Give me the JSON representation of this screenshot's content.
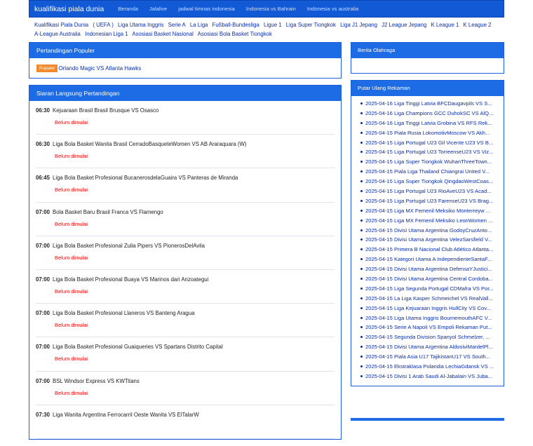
{
  "header": {
    "brand": "kualifikasi piala dunia",
    "nav": [
      "Beranda",
      "Jalalive",
      "jadwal timnas indonesia",
      "Indonesia vs Bahrain",
      "Indonesia vs australia"
    ]
  },
  "categories": [
    "Kualifikasi Piala Dunia",
    "( UEFA )",
    "Liga Utama Inggris",
    "Serie A",
    "La Liga",
    "Fußball-Bundesliga",
    "Ligue 1",
    "Liga Super Tiongkok",
    "Liga J1 Jepang",
    "J2 League Jepang",
    "K League 1",
    "K League 2",
    "A-League Australia",
    "Indonesian Liga 1",
    "Asosiasi Basket Nasional",
    "Asosiasi Bola Basket Tiongkok"
  ],
  "popular": {
    "title": "Pertandingan Populer",
    "badge": "Populer",
    "match": "Orlando Magic VS Atlanta Hawks"
  },
  "live": {
    "title": "Siaran Langsung Pertandingan",
    "matches": [
      {
        "time": "06:30",
        "name": "Kejuaraan Brasil Brasil Brusque VS Osasco",
        "status": "Belum dimulai"
      },
      {
        "time": "06:30",
        "name": "Liga Bola Basket Wanita Brasil CerradoBasqueteWomen VS AB Araraquara (W)",
        "status": "Belum dimulai"
      },
      {
        "time": "06:45",
        "name": "Liga Bola Basket Profesional BucanerosdelaGuaira VS Panteras de Miranda",
        "status": "Belum dimulai"
      },
      {
        "time": "07:00",
        "name": "Bola Basket Baru Brasil Franca VS Flamengo",
        "status": "Belum dimulai"
      },
      {
        "time": "07:00",
        "name": "Liga Bola Basket Profesional Zulia Pipers VS PionerosDelAvila",
        "status": "Belum dimulai"
      },
      {
        "time": "07:00",
        "name": "Liga Bola Basket Profesional Buaya VS Marinos dari Anzoategui",
        "status": "Belum dimulai"
      },
      {
        "time": "07:00",
        "name": "Liga Bola Basket Profesional Llaneros VS Banteng Aragua",
        "status": "Belum dimulai"
      },
      {
        "time": "07:00",
        "name": "Liga Bola Basket Profesional Guaiqueries VS Spartans Distrito Capital",
        "status": "Belum dimulai"
      },
      {
        "time": "07:00",
        "name": "BSL Windsor Express VS KWTitans",
        "status": "Belum dimulai"
      },
      {
        "time": "07:30",
        "name": "Liga Wanita Argentina Ferrocarril Oeste Wanita VS ElTalarW",
        "status": ""
      }
    ]
  },
  "news": {
    "title": "Berita Olahraga"
  },
  "replays": {
    "title": "Putar Ulang Rekaman",
    "items": [
      "2025-04-16 Liga Tinggi Latvia BFCDaugavpils VS S...",
      "2025-04-16 Liga Champions GCC DuhokSC VS AlQ...",
      "2025-04-16 Liga Tinggi Latvia Grobina VS RFS Rek...",
      "2025-04-15 Piala Rusia LokomotivMoscow VS Akh...",
      "2025-04-15 Liga Portugal U23 Gil Vicente U23 VS B...",
      "2025-04-15 Liga Portugal U23 TorreenseU23 VS Viz...",
      "2025-04-15 Liga Super Tiongkok WuhanThreeTown...",
      "2025-04-15 Piala Liga Thailand Chiangrai United V...",
      "2025-04-15 Liga Super Tiongkok QingdaoWestCoas...",
      "2025-04-15 Liga Portugal U23 RioAveU23 VS Acad...",
      "2025-04-15 Liga Portugal U23 FarenseU23 VS Brag...",
      "2025-04-15 Liga MX Femenil Meksiko Monterreyw ...",
      "2025-04-15 Liga MX Femenil Meksiko LeonWomen ...",
      "2025-04-15 Divisi Utama Argentina GodoyCruzAnto...",
      "2025-04-15 Divisi Utama Argentina VelezSarsfield V...",
      "2025-04-15 Primera B Nacional Club Atlético Atlanta...",
      "2025-04-15 Kategori Utama A IndependienteSantaF...",
      "2025-04-15 Divisi Utama Argentina DefensaYJustici...",
      "2025-04-15 Divisi Utama Argentina Central Cordoba...",
      "2025-04-15 Liga Segunda Portugal CDMafra VS Por...",
      "2025-04-15 La Liga Kasper Schmeichel VS RealVall...",
      "2025-04-15 Liga Kejuaraan Inggris HullCity VS Cov...",
      "2025-04-15 Liga Utama Inggris BournemouthAFC V...",
      "2025-04-15 Serie A Napoli VS Empoli Rekaman Put...",
      "2025-04-15 Segunda Division Spanyol Schmelzer, ...",
      "2025-04-15 Divisi Utama Argentina AldosiviMardelPl...",
      "2025-04-15 Piala Asia U17 TajikistanU17 VS South...",
      "2025-04-15 Ekstraklasa Polandia LechiaGdansk VS ...",
      "2025-04-15 Divisi 1 Arab Saudi Al-Jabalain VS Juba..."
    ]
  }
}
